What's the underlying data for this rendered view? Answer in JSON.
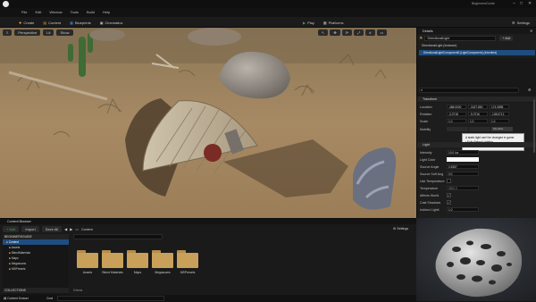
{
  "titlebar": {
    "project": "BeginnersGuide",
    "tab": "MAP_Main"
  },
  "menu": [
    "File",
    "Edit",
    "Window",
    "Tools",
    "Build",
    "Help"
  ],
  "toolbar": {
    "create": "Create",
    "content": "Content",
    "blueprints": "Blueprints",
    "cinematics": "Cinematics",
    "play": "Play",
    "platforms": "Platforms",
    "settings": "Settings"
  },
  "viewport": {
    "perspective": "Perspective",
    "lit": "Lit",
    "show": "Show"
  },
  "details": {
    "title": "Details",
    "actor": "DirectionalLight",
    "add": "+ Add",
    "root": "DirectionalLight (Instance)",
    "component": "DirectionalLightComponent0 (LightComponent) (Inherited)",
    "sections": {
      "transform": "Transform",
      "light": "Light"
    },
    "transform": {
      "location": {
        "label": "Location",
        "values": [
          "-486.0030",
          "-3427.850",
          "174.0895"
        ]
      },
      "rotation": {
        "label": "Rotation",
        "values": [
          "-3.0718",
          "-9.0716",
          "-108.5712"
        ]
      },
      "scale": {
        "label": "Scale",
        "values": [
          "1.0",
          "1.0",
          "1.0"
        ]
      },
      "mobility": {
        "label": "Mobility",
        "value": "Movable"
      }
    },
    "tooltip": [
      "A static light can't be changed in game.",
      "• Fully Baked Lighting",
      "• Fastest Rendering"
    ],
    "light": {
      "intensity": {
        "label": "Intensity",
        "value": "10.0 lux"
      },
      "light_color": {
        "label": "Light Color"
      },
      "source_angle": {
        "label": "Source Angle",
        "value": "0.5357"
      },
      "source_soft_angle": {
        "label": "Source Soft Ang",
        "value": "0.0"
      },
      "use_temperature": {
        "label": "Use Temperature"
      },
      "temperature": {
        "label": "Temperature",
        "value": "6500.0"
      },
      "affects_world": {
        "label": "Affects World"
      },
      "cast_shadows": {
        "label": "Cast Shadows"
      },
      "indirect": {
        "label": "Indirect Lighti",
        "value": "1.0"
      }
    }
  },
  "content_browser": {
    "title": "Content Browser",
    "add": "+ Add",
    "import": "Import",
    "save_all": "Save All",
    "path": "Content",
    "settings": "Settings",
    "tree_root": "BEGINNERSGUIDE",
    "tree": [
      "Content",
      "Assets",
      "BlendMaterials",
      "Maps",
      "Megascans",
      "MSPresets"
    ],
    "collections": "COLLECTIONS",
    "search_placeholder": "Search Content",
    "folders": [
      "Assets",
      "Blend Materials",
      "Maps",
      "Megascans",
      "MSPresets"
    ],
    "status": "5 items"
  },
  "bottom": {
    "content_drawer": "Content Drawer",
    "cmd": "Cmd"
  },
  "colors": {
    "accent": "#3ba34a",
    "selection": "#1f4d80",
    "folder": "#c9a05a"
  }
}
